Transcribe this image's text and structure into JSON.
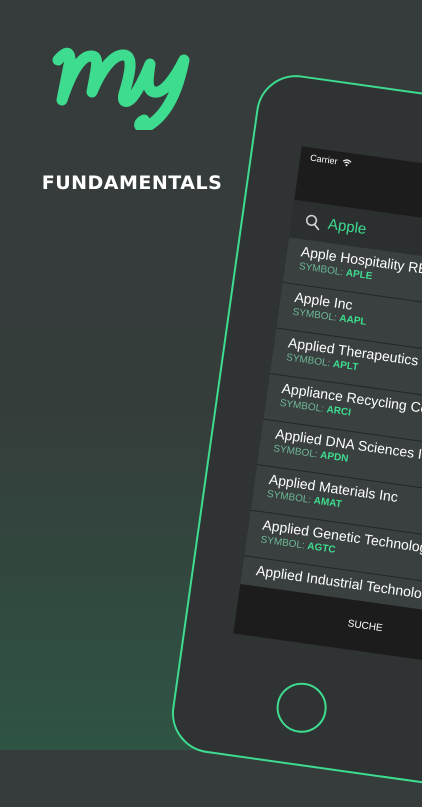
{
  "brand": {
    "logo_text": "my",
    "tagline": "FUNDAMENTALS",
    "accent": "#3ddc8f"
  },
  "phone": {
    "status_bar": {
      "carrier": "Carrier",
      "wifi_icon": "wifi-icon"
    },
    "search": {
      "icon": "search-icon",
      "query": "Apple"
    },
    "symbol_label": "SYMBOL:",
    "results": [
      {
        "name": "Apple Hospitality REIT",
        "symbol": "APLE"
      },
      {
        "name": "Apple Inc",
        "symbol": "AAPL"
      },
      {
        "name": "Applied Therapeutics Inc",
        "symbol": "APLT"
      },
      {
        "name": "Appliance Recycling Centers",
        "symbol": "ARCI"
      },
      {
        "name": "Applied DNA Sciences Inc",
        "symbol": "APDN"
      },
      {
        "name": "Applied Materials Inc",
        "symbol": "AMAT"
      },
      {
        "name": "Applied Genetic Technologies",
        "symbol": "AGTC"
      },
      {
        "name": "Applied Industrial Technologies"
      }
    ],
    "tab_bar": {
      "search_tab": "SUCHE"
    }
  }
}
